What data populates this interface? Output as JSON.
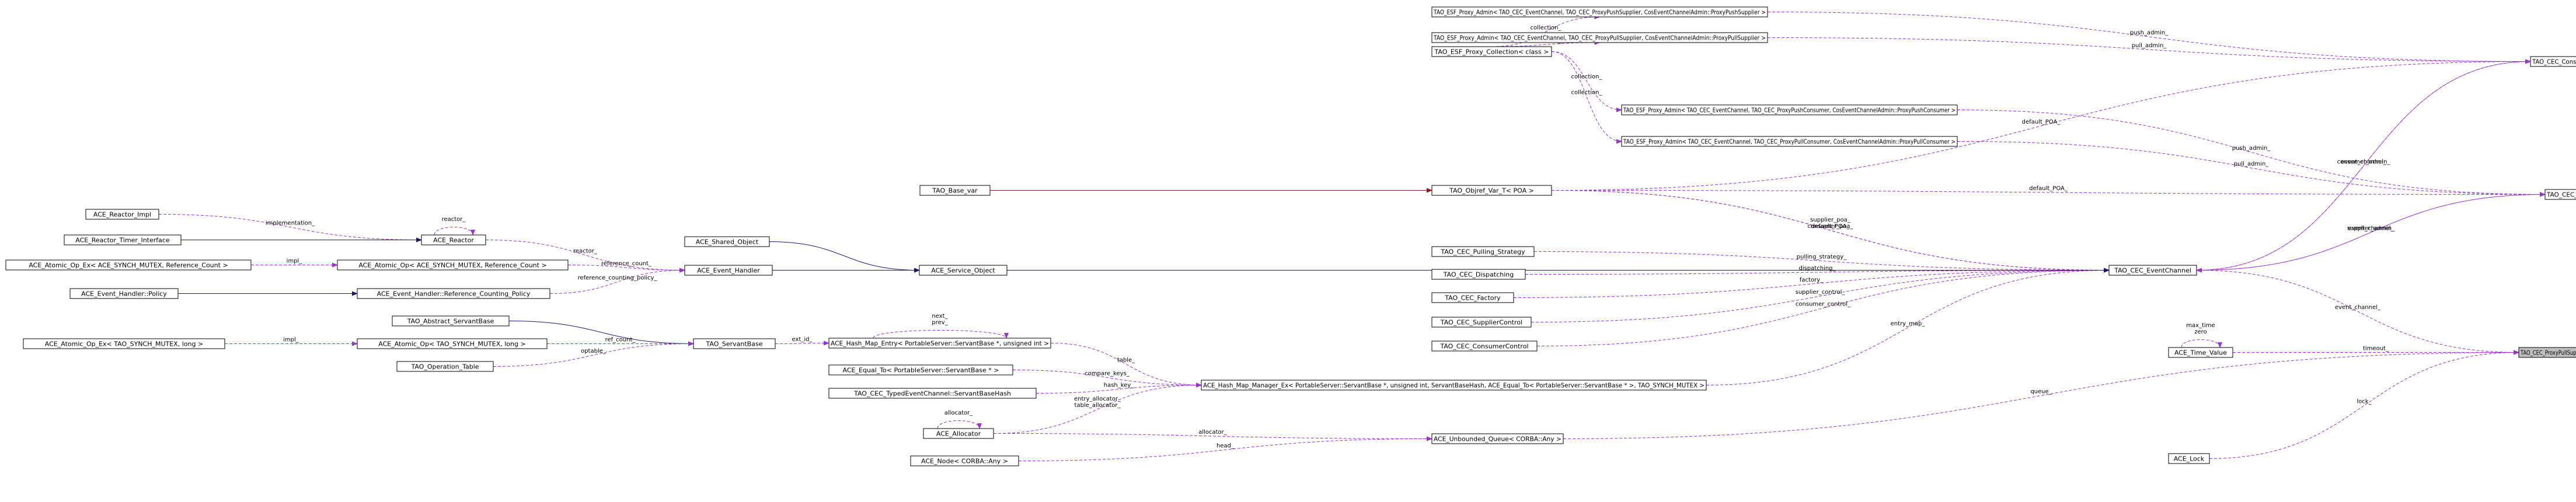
{
  "nodes": [
    {
      "id": "proxy_pull_supplier",
      "label": "TAO_CEC_ProxyPullSupplier",
      "focus": true
    },
    {
      "id": "time_value",
      "label": "ACE_Time_Value"
    },
    {
      "id": "ace_lock",
      "label": "ACE_Lock"
    },
    {
      "id": "event_channel",
      "label": "TAO_CEC_EventChannel"
    },
    {
      "id": "supplier_admin",
      "label": "TAO_CEC_SupplierAdmin"
    },
    {
      "id": "consumer_admin",
      "label": "TAO_CEC_ConsumerAdmin"
    },
    {
      "id": "esf_push_supplier",
      "label": "TAO_ESF_Proxy_Admin< TAO_CEC_EventChannel, TAO_CEC_ProxyPushSupplier, CosEventChannelAdmin::ProxyPushSupplier >"
    },
    {
      "id": "esf_pull_supplier",
      "label": "TAO_ESF_Proxy_Admin< TAO_CEC_EventChannel, TAO_CEC_ProxyPullSupplier, CosEventChannelAdmin::ProxyPullSupplier >"
    },
    {
      "id": "esf_collection",
      "label": "TAO_ESF_Proxy_Collection< class >"
    },
    {
      "id": "esf_push_consumer",
      "label": "TAO_ESF_Proxy_Admin< TAO_CEC_EventChannel, TAO_CEC_ProxyPushConsumer, CosEventChannelAdmin::ProxyPushConsumer >"
    },
    {
      "id": "esf_pull_consumer",
      "label": "TAO_ESF_Proxy_Admin< TAO_CEC_EventChannel, TAO_CEC_ProxyPullConsumer, CosEventChannelAdmin::ProxyPullConsumer >"
    },
    {
      "id": "objref_var",
      "label": "TAO_Objref_Var_T< POA >"
    },
    {
      "id": "base_var",
      "label": "TAO_Base_var"
    },
    {
      "id": "pulling_strategy",
      "label": "TAO_CEC_Pulling_Strategy"
    },
    {
      "id": "dispatching",
      "label": "TAO_CEC_Dispatching"
    },
    {
      "id": "factory",
      "label": "TAO_CEC_Factory"
    },
    {
      "id": "supplier_control",
      "label": "TAO_CEC_SupplierControl"
    },
    {
      "id": "consumer_control",
      "label": "TAO_CEC_ConsumerControl"
    },
    {
      "id": "hash_map_manager",
      "label": "ACE_Hash_Map_Manager_Ex< PortableServer::ServantBase *, unsigned int, ServantBaseHash, ACE_Equal_To< PortableServer::ServantBase * >, TAO_SYNCH_MUTEX >"
    },
    {
      "id": "hash_map_entry",
      "label": "ACE_Hash_Map_Entry< PortableServer::ServantBase *, unsigned int >"
    },
    {
      "id": "equal_to",
      "label": "ACE_Equal_To< PortableServer::ServantBase * >"
    },
    {
      "id": "servant_base_hash",
      "label": "TAO_CEC_TypedEventChannel::ServantBaseHash"
    },
    {
      "id": "ace_allocator",
      "label": "ACE_Allocator"
    },
    {
      "id": "unbounded_queue",
      "label": "ACE_Unbounded_Queue< CORBA::Any >"
    },
    {
      "id": "ace_node",
      "label": "ACE_Node< CORBA::Any >"
    },
    {
      "id": "service_object",
      "label": "ACE_Service_Object"
    },
    {
      "id": "shared_object",
      "label": "ACE_Shared_Object"
    },
    {
      "id": "event_handler",
      "label": "ACE_Event_Handler"
    },
    {
      "id": "ace_reactor",
      "label": "ACE_Reactor"
    },
    {
      "id": "reactor_impl",
      "label": "ACE_Reactor_Impl"
    },
    {
      "id": "reactor_timer_interface",
      "label": "ACE_Reactor_Timer_Interface"
    },
    {
      "id": "atomic_op_ref",
      "label": "ACE_Atomic_Op< ACE_SYNCH_MUTEX, Reference_Count >"
    },
    {
      "id": "atomic_op_ex_ref",
      "label": "ACE_Atomic_Op_Ex< ACE_SYNCH_MUTEX, Reference_Count >"
    },
    {
      "id": "refcounting_policy",
      "label": "ACE_Event_Handler::Reference_Counting_Policy"
    },
    {
      "id": "handler_policy",
      "label": "ACE_Event_Handler::Policy"
    },
    {
      "id": "servant_base",
      "label": "TAO_ServantBase"
    },
    {
      "id": "abstract_servant_base",
      "label": "TAO_Abstract_ServantBase"
    },
    {
      "id": "atomic_op_long",
      "label": "ACE_Atomic_Op< TAO_SYNCH_MUTEX, long >"
    },
    {
      "id": "atomic_op_ex_long",
      "label": "ACE_Atomic_Op_Ex< TAO_SYNCH_MUTEX, long >"
    },
    {
      "id": "operation_table",
      "label": "TAO_Operation_Table"
    }
  ],
  "edges": [
    {
      "from": "time_value",
      "to": "proxy_pull_supplier",
      "kind": "use",
      "label": "timeout_"
    },
    {
      "from": "time_value",
      "to": "time_value",
      "kind": "use",
      "label": "max_time\nzero"
    },
    {
      "from": "ace_lock",
      "to": "proxy_pull_supplier",
      "kind": "use",
      "label": "lock_"
    },
    {
      "from": "event_channel",
      "to": "proxy_pull_supplier",
      "kind": "use",
      "label": "event_channel_"
    },
    {
      "from": "unbounded_queue",
      "to": "proxy_pull_supplier",
      "kind": "use",
      "label": "queue_"
    },
    {
      "from": "supplier_admin",
      "to": "event_channel",
      "kind": "use",
      "label": "supplier_admin_"
    },
    {
      "from": "consumer_admin",
      "to": "event_channel",
      "kind": "use",
      "label": "consumer_admin_"
    },
    {
      "from": "event_channel",
      "to": "supplier_admin",
      "kind": "use",
      "label": "event_channel_"
    },
    {
      "from": "event_channel",
      "to": "consumer_admin",
      "kind": "use",
      "label": "event_channel_"
    },
    {
      "from": "esf_push_supplier",
      "to": "consumer_admin",
      "kind": "use",
      "label": "push_admin_"
    },
    {
      "from": "esf_pull_supplier",
      "to": "consumer_admin",
      "kind": "use",
      "label": "pull_admin_"
    },
    {
      "from": "objref_var",
      "to": "consumer_admin",
      "kind": "use",
      "label": "default_POA_"
    },
    {
      "from": "esf_push_consumer",
      "to": "supplier_admin",
      "kind": "use",
      "label": "push_admin_"
    },
    {
      "from": "esf_pull_consumer",
      "to": "supplier_admin",
      "kind": "use",
      "label": "pull_admin_"
    },
    {
      "from": "objref_var",
      "to": "supplier_admin",
      "kind": "use",
      "label": "default_POA_"
    },
    {
      "from": "esf_collection",
      "to": "esf_push_supplier",
      "kind": "use",
      "label": "collection_"
    },
    {
      "from": "esf_collection",
      "to": "esf_pull_supplier",
      "kind": "use",
      "label": "collection_"
    },
    {
      "from": "esf_collection",
      "to": "esf_push_consumer",
      "kind": "use",
      "label": "collection_"
    },
    {
      "from": "esf_collection",
      "to": "esf_pull_consumer",
      "kind": "use",
      "label": "collection_"
    },
    {
      "from": "base_var",
      "to": "objref_var",
      "kind": "owner",
      "label": ""
    },
    {
      "from": "objref_var",
      "to": "event_channel",
      "kind": "use",
      "label": "supplier_poa_\nconsumer_poa_"
    },
    {
      "from": "objref_var",
      "to": "event_channel",
      "kind": "use",
      "label": "default_POA_"
    },
    {
      "from": "pulling_strategy",
      "to": "event_channel",
      "kind": "use",
      "label": "pulling_strategy_"
    },
    {
      "from": "dispatching",
      "to": "event_channel",
      "kind": "use",
      "label": "dispatching_"
    },
    {
      "from": "factory",
      "to": "event_channel",
      "kind": "use",
      "label": "factory_"
    },
    {
      "from": "supplier_control",
      "to": "event_channel",
      "kind": "use",
      "label": "supplier_control_"
    },
    {
      "from": "consumer_control",
      "to": "event_channel",
      "kind": "use",
      "label": "consumer_control_"
    },
    {
      "from": "hash_map_manager",
      "to": "event_channel",
      "kind": "use",
      "label": "entry_map_"
    },
    {
      "from": "service_object",
      "to": "event_channel",
      "kind": "inherit",
      "label": ""
    },
    {
      "from": "hash_map_entry",
      "to": "hash_map_manager",
      "kind": "use",
      "label": "table_"
    },
    {
      "from": "hash_map_entry",
      "to": "hash_map_entry",
      "kind": "use",
      "label": "next_\nprev_"
    },
    {
      "from": "equal_to",
      "to": "hash_map_manager",
      "kind": "use",
      "label": "compare_keys_"
    },
    {
      "from": "servant_base_hash",
      "to": "hash_map_manager",
      "kind": "use",
      "label": "hash_key_"
    },
    {
      "from": "ace_allocator",
      "to": "hash_map_manager",
      "kind": "use",
      "label": "entry_allocator_\ntable_allocator_"
    },
    {
      "from": "ace_allocator",
      "to": "ace_allocator",
      "kind": "use",
      "label": "allocator_"
    },
    {
      "from": "ace_allocator",
      "to": "unbounded_queue",
      "kind": "use",
      "label": "allocator_"
    },
    {
      "from": "ace_node",
      "to": "unbounded_queue",
      "kind": "use",
      "label": "head_"
    },
    {
      "from": "servant_base",
      "to": "hash_map_entry",
      "kind": "use",
      "label": "ext_id_"
    },
    {
      "from": "shared_object",
      "to": "service_object",
      "kind": "inherit",
      "label": ""
    },
    {
      "from": "event_handler",
      "to": "service_object",
      "kind": "inherit",
      "label": ""
    },
    {
      "from": "ace_reactor",
      "to": "event_handler",
      "kind": "use",
      "label": "reactor_"
    },
    {
      "from": "ace_reactor",
      "to": "ace_reactor",
      "kind": "use",
      "label": "reactor_"
    },
    {
      "from": "reactor_impl",
      "to": "ace_reactor",
      "kind": "use",
      "label": "implementation_"
    },
    {
      "from": "reactor_timer_interface",
      "to": "ace_reactor",
      "kind": "inherit",
      "label": ""
    },
    {
      "from": "atomic_op_ref",
      "to": "event_handler",
      "kind": "use",
      "label": "reference_count_"
    },
    {
      "from": "atomic_op_ex_ref",
      "to": "atomic_op_ref",
      "kind": "use",
      "label": "impl_"
    },
    {
      "from": "refcounting_policy",
      "to": "event_handler",
      "kind": "use",
      "label": "reference_counting_policy_"
    },
    {
      "from": "handler_policy",
      "to": "refcounting_policy",
      "kind": "inherit",
      "label": ""
    },
    {
      "from": "abstract_servant_base",
      "to": "servant_base",
      "kind": "inherit",
      "label": ""
    },
    {
      "from": "atomic_op_long",
      "to": "servant_base",
      "kind": "use",
      "label": "ref_count_"
    },
    {
      "from": "atomic_op_ex_long",
      "to": "atomic_op_long",
      "kind": "use",
      "label": "impl_"
    },
    {
      "from": "operation_table",
      "to": "servant_base",
      "kind": "use",
      "label": "optable_"
    }
  ]
}
